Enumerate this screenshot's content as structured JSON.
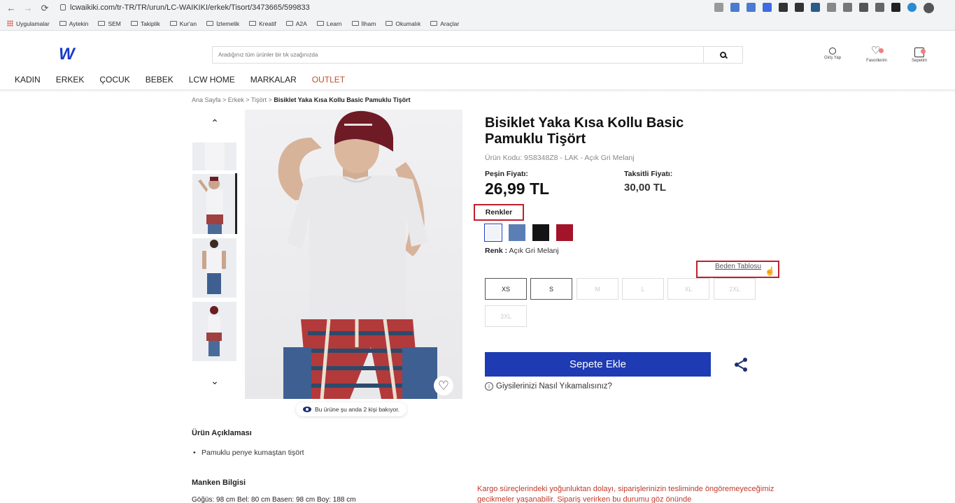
{
  "browser": {
    "url": "lcwaikiki.com/tr-TR/TR/urun/LC-WAIKIKI/erkek/Tisort/3473665/599833",
    "back": "←",
    "forward": "→",
    "reload": "⟳",
    "bookmarks": [
      "Uygulamalar",
      "Aytekin",
      "SEM",
      "Takiplik",
      "Kur'an",
      "İzlemelik",
      "Kreatif",
      "A2A",
      "Learn",
      "İlham",
      "Okumalık",
      "Araçlar"
    ]
  },
  "header": {
    "logo": "W",
    "search_placeholder": "Aradığınız tüm ürünler bir tık uzağınızda",
    "icons": {
      "login": "Giriş Yap",
      "favorites": "Favorilerim",
      "cart": "Sepetim"
    }
  },
  "nav": [
    "KADIN",
    "ERKEK",
    "ÇOCUK",
    "BEBEK",
    "LCW HOME",
    "MARKALAR",
    "OUTLET"
  ],
  "breadcrumb": {
    "path": "Ana Sayfa > Erkek > Tişört >",
    "current": "Bisiklet Yaka Kısa Kollu Basic Pamuklu Tişört"
  },
  "gallery": {
    "up": "⌃",
    "down": "⌄",
    "heart": "♡",
    "viewers_text": "Bu ürüne şu anda 2 kişi bakıyor."
  },
  "product": {
    "title": "Bisiklet Yaka Kısa Kollu Basic Pamuklu Tişört",
    "code": "Ürün Kodu: 9S8348Z8 - LAK - Açık Gri Melanj",
    "cash_price_label": "Peşin Fiyatı:",
    "cash_price": "26,99 TL",
    "installment_label": "Taksitli Fiyatı:",
    "installment_price": "30,00 TL",
    "colors_label": "Renkler",
    "colors": [
      "#f2f3f7",
      "#5b7fb5",
      "#141414",
      "#a3132a"
    ],
    "selected_color_label": "Renk :",
    "selected_color": "Açık Gri Melanj",
    "size_chart": "Beden Tablosu",
    "sizes": [
      {
        "label": "XS",
        "available": true
      },
      {
        "label": "S",
        "available": true
      },
      {
        "label": "M",
        "available": false
      },
      {
        "label": "L",
        "available": false
      },
      {
        "label": "XL",
        "available": false
      },
      {
        "label": "2XL",
        "available": false
      },
      {
        "label": "3XL",
        "available": false
      }
    ],
    "add_to_cart": "Sepete Ekle",
    "wash_info": "Giysilerinizi Nasıl Yıkamalısınız?",
    "info_glyph": "i"
  },
  "description": {
    "heading": "Ürün Açıklaması",
    "bullets": [
      "Pamuklu penye kumaştan tişört"
    ],
    "model_heading": "Manken Bilgisi",
    "model_info": "Göğüs: 98 cm Bel: 80 cm Basen: 98 cm Boy: 188 cm"
  },
  "notice": "Kargo süreçlerindeki yoğunluktan dolayı, siparişlerinizin tesliminde öngöremeyeceğimiz gecikmeler yaşanabilir. Sipariş verirken bu durumu göz önünde"
}
